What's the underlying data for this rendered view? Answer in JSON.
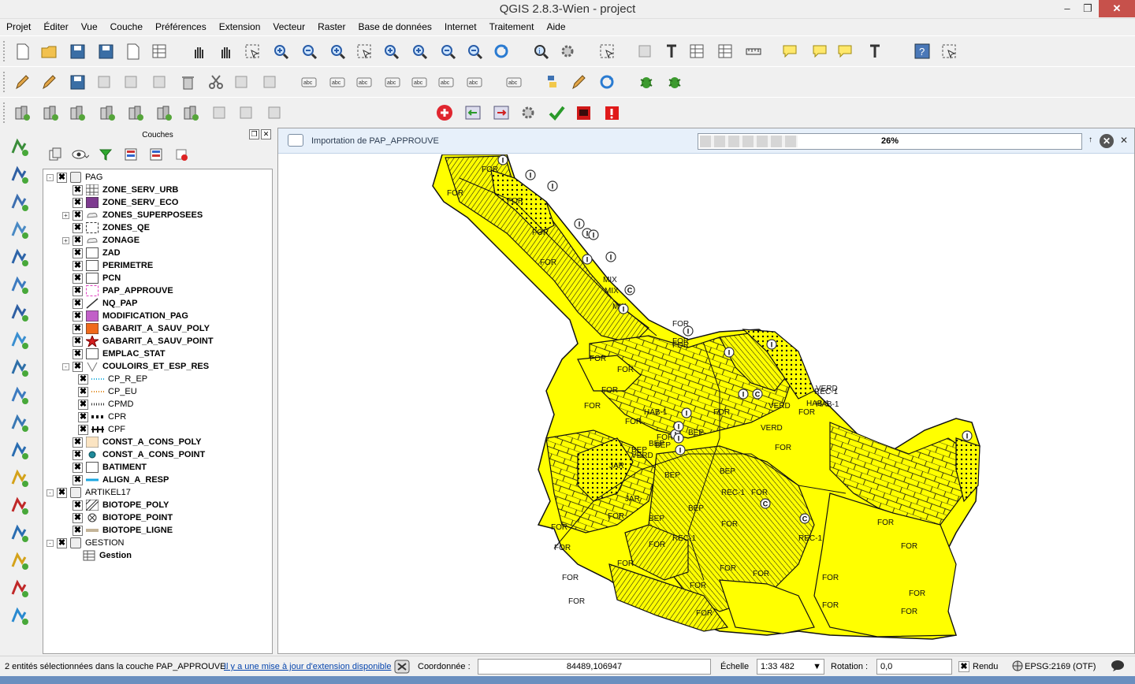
{
  "window": {
    "title": "QGIS 2.8.3-Wien - project"
  },
  "menu": [
    "Projet",
    "Éditer",
    "Vue",
    "Couche",
    "Préférences",
    "Extension",
    "Vecteur",
    "Raster",
    "Base de données",
    "Internet",
    "Traitement",
    "Aide"
  ],
  "layers_panel": {
    "title": "Couches"
  },
  "layers": [
    {
      "label": "PAG",
      "group": true,
      "expand": "-",
      "level": 0,
      "bold": false
    },
    {
      "label": "ZONE_SERV_URB",
      "level": 1,
      "bold": true,
      "symbol": "grid"
    },
    {
      "label": "ZONE_SERV_ECO",
      "level": 1,
      "bold": true,
      "symbol": "purple"
    },
    {
      "label": "ZONES_SUPERPOSEES",
      "level": 1,
      "bold": true,
      "symbol": "cloud",
      "expand": "+"
    },
    {
      "label": "ZONES_QE",
      "level": 1,
      "bold": true,
      "symbol": "dashed"
    },
    {
      "label": "ZONAGE",
      "level": 1,
      "bold": true,
      "symbol": "cloud",
      "expand": "+"
    },
    {
      "label": "ZAD",
      "level": 1,
      "bold": true,
      "symbol": "white"
    },
    {
      "label": "PERIMETRE",
      "level": 1,
      "bold": true,
      "symbol": "white"
    },
    {
      "label": "PCN",
      "level": 1,
      "bold": true,
      "symbol": "white"
    },
    {
      "label": "PAP_APPROUVE",
      "level": 1,
      "bold": true,
      "symbol": "pinkdash"
    },
    {
      "label": "NQ_PAP",
      "level": 1,
      "bold": true,
      "symbol": "diag"
    },
    {
      "label": "MODIFICATION_PAG",
      "level": 1,
      "bold": true,
      "symbol": "violet"
    },
    {
      "label": "GABARIT_A_SAUV_POLY",
      "level": 1,
      "bold": true,
      "symbol": "orange"
    },
    {
      "label": "GABARIT_A_SAUV_POINT",
      "level": 1,
      "bold": true,
      "symbol": "star"
    },
    {
      "label": "EMPLAC_STAT",
      "level": 1,
      "bold": true,
      "symbol": "white"
    },
    {
      "label": "COULOIRS_ET_ESP_RES",
      "level": 1,
      "bold": true,
      "symbol": "vline",
      "expand": "-"
    },
    {
      "label": "CP_R_EP",
      "level": 2,
      "bold": false,
      "symbol": "line-cyan"
    },
    {
      "label": "CP_EU",
      "level": 2,
      "bold": false,
      "symbol": "line-orange"
    },
    {
      "label": "CPMD",
      "level": 2,
      "bold": false,
      "symbol": "line-dots"
    },
    {
      "label": "CPR",
      "level": 2,
      "bold": false,
      "symbol": "line-heavy"
    },
    {
      "label": "CPF",
      "level": 2,
      "bold": false,
      "symbol": "line-bar"
    },
    {
      "label": "CONST_A_CONS_POLY",
      "level": 1,
      "bold": true,
      "symbol": "beige"
    },
    {
      "label": "CONST_A_CONS_POINT",
      "level": 1,
      "bold": true,
      "symbol": "dot-teal"
    },
    {
      "label": "BATIMENT",
      "level": 1,
      "bold": true,
      "symbol": "white"
    },
    {
      "label": "ALIGN_A_RESP",
      "level": 1,
      "bold": true,
      "symbol": "line-blue"
    },
    {
      "label": "ARTIKEL17",
      "group": true,
      "expand": "-",
      "level": 0,
      "bold": false
    },
    {
      "label": "BIOTOPE_POLY",
      "level": 1,
      "bold": true,
      "symbol": "hatch"
    },
    {
      "label": "BIOTOPE_POINT",
      "level": 1,
      "bold": true,
      "symbol": "circle-x"
    },
    {
      "label": "BIOTOPE_LIGNE",
      "level": 1,
      "bold": true,
      "symbol": "line-brown"
    },
    {
      "label": "GESTION",
      "group": true,
      "expand": "-",
      "level": 0,
      "bold": false
    },
    {
      "label": "Gestion",
      "level": 1,
      "bold": true,
      "symbol": "table",
      "nochk": true
    }
  ],
  "message_bar": {
    "text": "Importation de PAP_APPROUVE",
    "progress": 0.26,
    "progress_label": "26%"
  },
  "map": {
    "fill_color": "#ffff00",
    "labels": [
      "FOR",
      "FOR",
      "FOR",
      "FOR",
      "FOR",
      "FOR",
      "FOR",
      "FOR",
      "FOR",
      "FOR",
      "FOR",
      "FOR",
      "FOR",
      "FOR",
      "FOR",
      "FOR",
      "FOR",
      "FOR",
      "FOR",
      "FOR",
      "FOR",
      "FOR",
      "FOR",
      "FOR",
      "FOR",
      "FOR",
      "FOR",
      "FOR",
      "FOR",
      "FOR",
      "FOR",
      "FOR",
      "FOR",
      "FOR",
      "FOR",
      "BEP",
      "BEP",
      "BEP",
      "BEP",
      "BEP",
      "BEP",
      "REC-1",
      "REC-1",
      "REC-1",
      "HAB-1",
      "HAB-1",
      "VERD",
      "VERD",
      "VERD",
      "MIX",
      "MIX",
      "MIX",
      "JAR",
      "JAR",
      "REC-1",
      "VERD",
      "BEP",
      "FOR",
      "BEP",
      "HAB-1"
    ],
    "markers": [
      "I",
      "I",
      "I",
      "I",
      "I",
      "I",
      "I",
      "I",
      "C",
      "I",
      "I",
      "I",
      "I",
      "I",
      "I",
      "I",
      "C",
      "I",
      "I",
      "I",
      "C",
      "C",
      "I"
    ]
  },
  "status": {
    "selection": "2 entités sélectionnées dans la couche PAP_APPROUVE.",
    "update_link": "Il y a une mise à jour d'extension disponible",
    "coord_label": "Coordonnée :",
    "coord_value": "84489,106947",
    "scale_label": "Échelle",
    "scale_value": "1:33 482",
    "rotation_label": "Rotation :",
    "rotation_value": "0,0",
    "render_label": "Rendu",
    "crs": "EPSG:2169 (OTF)"
  }
}
